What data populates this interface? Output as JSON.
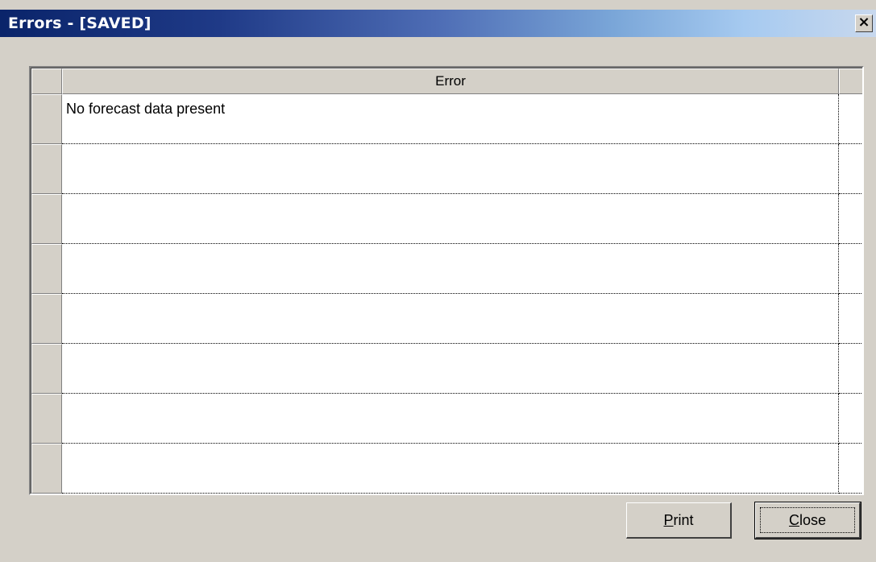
{
  "window": {
    "title": "Errors - [SAVED]",
    "close_glyph": "×"
  },
  "grid": {
    "columns": [
      "Error"
    ],
    "rows": [
      {
        "error": "No forecast data present"
      },
      {
        "error": ""
      },
      {
        "error": ""
      },
      {
        "error": ""
      },
      {
        "error": ""
      },
      {
        "error": ""
      },
      {
        "error": ""
      },
      {
        "error": ""
      }
    ]
  },
  "buttons": {
    "print": {
      "mnemonic": "P",
      "rest": "rint"
    },
    "close": {
      "mnemonic": "C",
      "rest": "lose"
    }
  },
  "colors": {
    "titlebar_start": "#0a246a",
    "titlebar_end": "#a6caf0",
    "face": "#d4d0c8"
  }
}
